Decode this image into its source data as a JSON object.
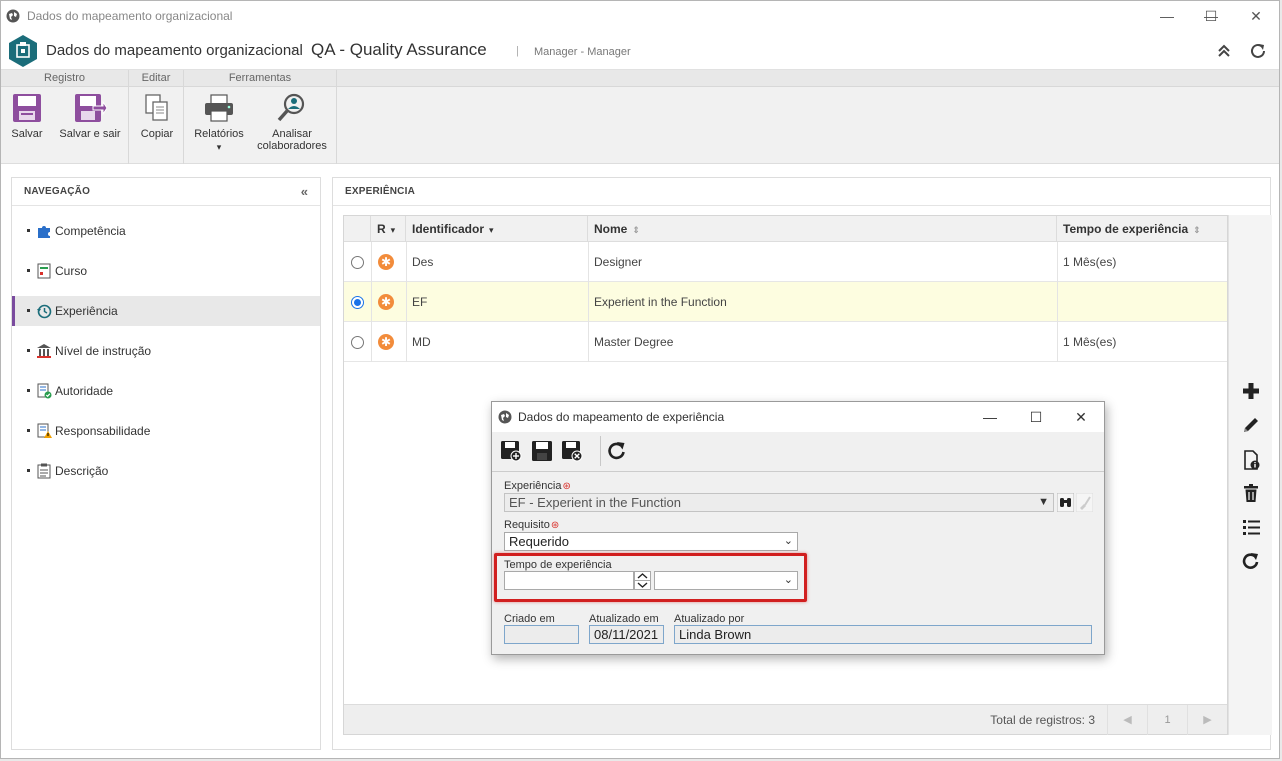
{
  "window": {
    "title": "Dados do mapeamento organizacional",
    "controls": {
      "minimize": "—",
      "maximize": "☐",
      "close": "✕"
    }
  },
  "header": {
    "breadcrumb": "Dados do mapeamento organizacional",
    "title": "QA - Quality Assurance",
    "separator": "|",
    "subtitle": "Manager - Manager"
  },
  "ribbon": {
    "groups": [
      {
        "title": "Registro",
        "buttons": [
          "Salvar",
          "Salvar e sair"
        ]
      },
      {
        "title": "Editar",
        "buttons": [
          "Copiar"
        ]
      },
      {
        "title": "Ferramentas",
        "buttons": [
          "Relatórios",
          "Analisar colaboradores"
        ]
      }
    ],
    "analisar_line1": "Analisar",
    "analisar_line2": "colaboradores",
    "relatorios_caret": "▾"
  },
  "navigation": {
    "title": "NAVEGAÇÃO",
    "collapse_glyph": "«",
    "items": [
      {
        "label": "Competência",
        "icon": "puzzle-icon"
      },
      {
        "label": "Curso",
        "icon": "course-icon"
      },
      {
        "label": "Experiência",
        "icon": "history-clock-icon",
        "active": true
      },
      {
        "label": "Nível de instrução",
        "icon": "institution-icon"
      },
      {
        "label": "Autoridade",
        "icon": "authority-check-icon"
      },
      {
        "label": "Responsabilidade",
        "icon": "responsibility-warning-icon"
      },
      {
        "label": "Descrição",
        "icon": "clipboard-icon"
      }
    ]
  },
  "content": {
    "title": "EXPERIÊNCIA",
    "columns": [
      "R",
      "Identificador",
      "Nome",
      "Tempo de experiência"
    ],
    "rows": [
      {
        "id": "Des",
        "name": "Designer",
        "time": "1 Mês(es)",
        "selected": false
      },
      {
        "id": "EF",
        "name": "Experient in the Function",
        "time": "",
        "selected": true
      },
      {
        "id": "MD",
        "name": "Master Degree",
        "time": "1 Mês(es)",
        "selected": false
      }
    ],
    "footer": {
      "total": "Total de registros: 3",
      "page": "1",
      "prev": "◀",
      "next": "▶"
    }
  },
  "dialog": {
    "title": "Dados do mapeamento de experiência",
    "controls": {
      "minimize": "—",
      "maximize": "☐",
      "close": "✕"
    },
    "experiencia_label": "Experiência",
    "experiencia_value": "EF - Experient in the Function",
    "requisito_label": "Requisito",
    "requisito_value": "Requerido",
    "tempo_label": "Tempo de experiência",
    "tempo_value": "",
    "tempo_unit": "",
    "criado_em_label": "Criado em",
    "criado_em_value": "",
    "atualizado_em_label": "Atualizado em",
    "atualizado_em_value": "08/11/2021",
    "atualizado_por_label": "Atualizado por",
    "atualizado_por_value": "Linda Brown",
    "required_mark": "⊛"
  },
  "colors": {
    "accent_purple": "#7a4b9e",
    "brand_teal": "#1b6d7a",
    "highlight_red": "#d11f1f",
    "selected_row": "#fdfde0",
    "required_orange": "#f28c3b"
  }
}
